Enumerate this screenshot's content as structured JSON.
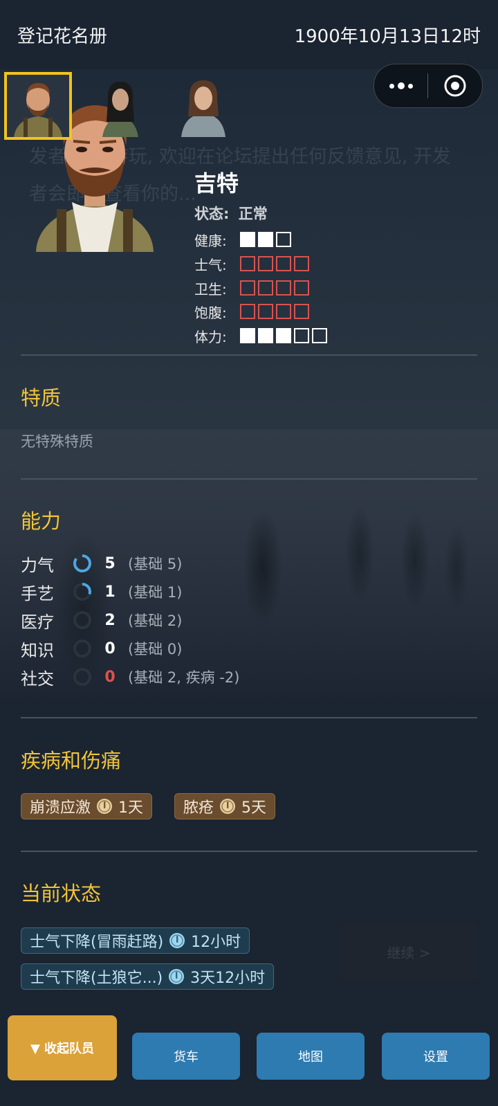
{
  "header": {
    "title": "登记花名册",
    "datetime": "1900年10月13日12时"
  },
  "background": {
    "ghost_text": "发者 感谢游玩, 欢迎在论坛提出任何反馈意见, 开发者会即时查看你的...",
    "continue_label": "继续 >"
  },
  "roster": [
    {
      "name": "portrait-jeet",
      "selected": true
    },
    {
      "name": "portrait-girl",
      "selected": false
    },
    {
      "name": "portrait-woman",
      "selected": false
    }
  ],
  "character": {
    "name": "吉特",
    "status_label": "状态:",
    "status_value": "正常",
    "stats": [
      {
        "label": "健康:",
        "filled": 2,
        "total": 3,
        "bad": false
      },
      {
        "label": "士气:",
        "filled": 0,
        "total": 4,
        "bad": true
      },
      {
        "label": "卫生:",
        "filled": 0,
        "total": 4,
        "bad": true
      },
      {
        "label": "饱腹:",
        "filled": 0,
        "total": 4,
        "bad": true
      },
      {
        "label": "体力:",
        "filled": 3,
        "total": 5,
        "bad": false
      }
    ]
  },
  "traits": {
    "title": "特质",
    "empty_text": "无特殊特质"
  },
  "abilities": {
    "title": "能力",
    "items": [
      {
        "name": "力气",
        "value": "5",
        "base": "(基础 5)",
        "progress": 0.85,
        "red": false
      },
      {
        "name": "手艺",
        "value": "1",
        "base": "(基础 1)",
        "progress": 0.3,
        "red": false
      },
      {
        "name": "医疗",
        "value": "2",
        "base": "(基础 2)",
        "progress": 0,
        "red": false
      },
      {
        "name": "知识",
        "value": "0",
        "base": "(基础 0)",
        "progress": 0,
        "red": false
      },
      {
        "name": "社交",
        "value": "0",
        "base": "(基础 2, 疾病 -2)",
        "progress": 0,
        "red": true
      }
    ]
  },
  "diseases": {
    "title": "疾病和伤痛",
    "items": [
      {
        "name": "崩溃应激",
        "duration": "1天"
      },
      {
        "name": "脓疮",
        "duration": "5天"
      }
    ]
  },
  "current_status": {
    "title": "当前状态",
    "items": [
      {
        "name": "士气下降(冒雨赶路)",
        "duration": "12小时"
      },
      {
        "name": "士气下降(土狼它...)",
        "duration": "3天12小时"
      }
    ]
  },
  "bottom_nav": {
    "collapse_label": "▼ 收起队员",
    "truck_label": "货车",
    "map_label": "地图",
    "settings_label": "设置"
  },
  "colors": {
    "accent_yellow": "#f0c43a",
    "selected_border": "#f2c31c",
    "bad_red": "#d9534f",
    "button_blue": "#2d7bb1",
    "button_orange": "#dba23a"
  }
}
